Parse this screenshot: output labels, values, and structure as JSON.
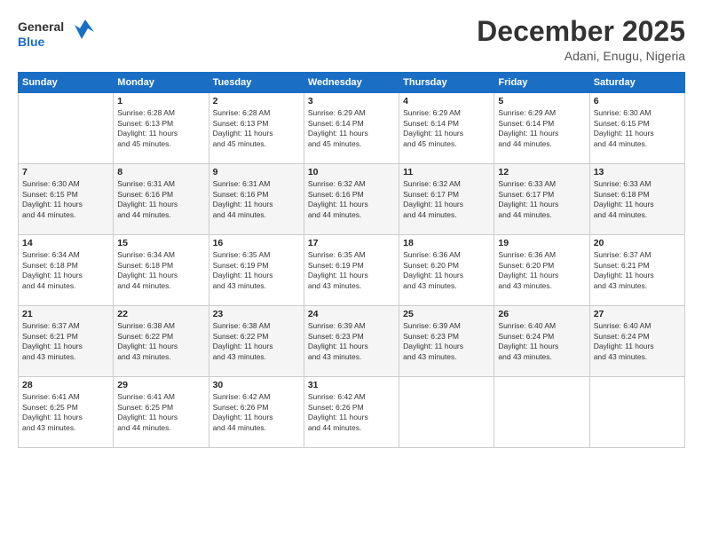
{
  "header": {
    "logo_line1": "General",
    "logo_line2": "Blue",
    "month": "December 2025",
    "location": "Adani, Enugu, Nigeria"
  },
  "days_of_week": [
    "Sunday",
    "Monday",
    "Tuesday",
    "Wednesday",
    "Thursday",
    "Friday",
    "Saturday"
  ],
  "weeks": [
    [
      {
        "day": "",
        "info": ""
      },
      {
        "day": "1",
        "info": "Sunrise: 6:28 AM\nSunset: 6:13 PM\nDaylight: 11 hours\nand 45 minutes."
      },
      {
        "day": "2",
        "info": "Sunrise: 6:28 AM\nSunset: 6:13 PM\nDaylight: 11 hours\nand 45 minutes."
      },
      {
        "day": "3",
        "info": "Sunrise: 6:29 AM\nSunset: 6:14 PM\nDaylight: 11 hours\nand 45 minutes."
      },
      {
        "day": "4",
        "info": "Sunrise: 6:29 AM\nSunset: 6:14 PM\nDaylight: 11 hours\nand 45 minutes."
      },
      {
        "day": "5",
        "info": "Sunrise: 6:29 AM\nSunset: 6:14 PM\nDaylight: 11 hours\nand 44 minutes."
      },
      {
        "day": "6",
        "info": "Sunrise: 6:30 AM\nSunset: 6:15 PM\nDaylight: 11 hours\nand 44 minutes."
      }
    ],
    [
      {
        "day": "7",
        "info": "Sunrise: 6:30 AM\nSunset: 6:15 PM\nDaylight: 11 hours\nand 44 minutes."
      },
      {
        "day": "8",
        "info": "Sunrise: 6:31 AM\nSunset: 6:16 PM\nDaylight: 11 hours\nand 44 minutes."
      },
      {
        "day": "9",
        "info": "Sunrise: 6:31 AM\nSunset: 6:16 PM\nDaylight: 11 hours\nand 44 minutes."
      },
      {
        "day": "10",
        "info": "Sunrise: 6:32 AM\nSunset: 6:16 PM\nDaylight: 11 hours\nand 44 minutes."
      },
      {
        "day": "11",
        "info": "Sunrise: 6:32 AM\nSunset: 6:17 PM\nDaylight: 11 hours\nand 44 minutes."
      },
      {
        "day": "12",
        "info": "Sunrise: 6:33 AM\nSunset: 6:17 PM\nDaylight: 11 hours\nand 44 minutes."
      },
      {
        "day": "13",
        "info": "Sunrise: 6:33 AM\nSunset: 6:18 PM\nDaylight: 11 hours\nand 44 minutes."
      }
    ],
    [
      {
        "day": "14",
        "info": "Sunrise: 6:34 AM\nSunset: 6:18 PM\nDaylight: 11 hours\nand 44 minutes."
      },
      {
        "day": "15",
        "info": "Sunrise: 6:34 AM\nSunset: 6:18 PM\nDaylight: 11 hours\nand 44 minutes."
      },
      {
        "day": "16",
        "info": "Sunrise: 6:35 AM\nSunset: 6:19 PM\nDaylight: 11 hours\nand 43 minutes."
      },
      {
        "day": "17",
        "info": "Sunrise: 6:35 AM\nSunset: 6:19 PM\nDaylight: 11 hours\nand 43 minutes."
      },
      {
        "day": "18",
        "info": "Sunrise: 6:36 AM\nSunset: 6:20 PM\nDaylight: 11 hours\nand 43 minutes."
      },
      {
        "day": "19",
        "info": "Sunrise: 6:36 AM\nSunset: 6:20 PM\nDaylight: 11 hours\nand 43 minutes."
      },
      {
        "day": "20",
        "info": "Sunrise: 6:37 AM\nSunset: 6:21 PM\nDaylight: 11 hours\nand 43 minutes."
      }
    ],
    [
      {
        "day": "21",
        "info": "Sunrise: 6:37 AM\nSunset: 6:21 PM\nDaylight: 11 hours\nand 43 minutes."
      },
      {
        "day": "22",
        "info": "Sunrise: 6:38 AM\nSunset: 6:22 PM\nDaylight: 11 hours\nand 43 minutes."
      },
      {
        "day": "23",
        "info": "Sunrise: 6:38 AM\nSunset: 6:22 PM\nDaylight: 11 hours\nand 43 minutes."
      },
      {
        "day": "24",
        "info": "Sunrise: 6:39 AM\nSunset: 6:23 PM\nDaylight: 11 hours\nand 43 minutes."
      },
      {
        "day": "25",
        "info": "Sunrise: 6:39 AM\nSunset: 6:23 PM\nDaylight: 11 hours\nand 43 minutes."
      },
      {
        "day": "26",
        "info": "Sunrise: 6:40 AM\nSunset: 6:24 PM\nDaylight: 11 hours\nand 43 minutes."
      },
      {
        "day": "27",
        "info": "Sunrise: 6:40 AM\nSunset: 6:24 PM\nDaylight: 11 hours\nand 43 minutes."
      }
    ],
    [
      {
        "day": "28",
        "info": "Sunrise: 6:41 AM\nSunset: 6:25 PM\nDaylight: 11 hours\nand 43 minutes."
      },
      {
        "day": "29",
        "info": "Sunrise: 6:41 AM\nSunset: 6:25 PM\nDaylight: 11 hours\nand 44 minutes."
      },
      {
        "day": "30",
        "info": "Sunrise: 6:42 AM\nSunset: 6:26 PM\nDaylight: 11 hours\nand 44 minutes."
      },
      {
        "day": "31",
        "info": "Sunrise: 6:42 AM\nSunset: 6:26 PM\nDaylight: 11 hours\nand 44 minutes."
      },
      {
        "day": "",
        "info": ""
      },
      {
        "day": "",
        "info": ""
      },
      {
        "day": "",
        "info": ""
      }
    ]
  ]
}
